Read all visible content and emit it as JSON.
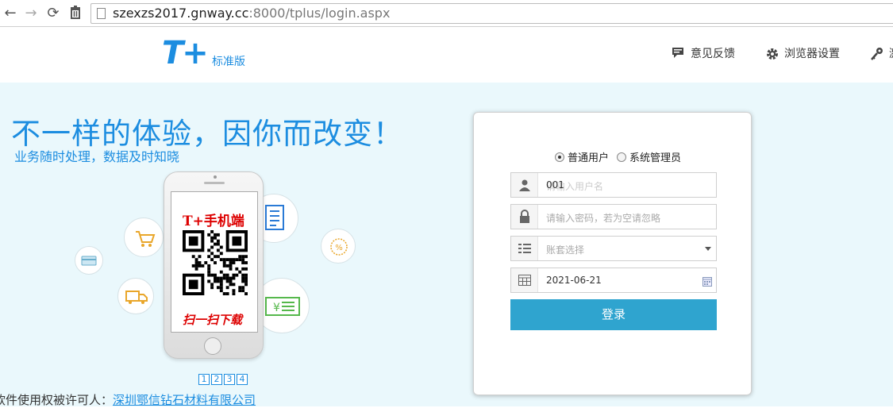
{
  "browser": {
    "url_host": "szexzs2017.gnway.cc",
    "url_rest": ":8000/tplus/login.aspx"
  },
  "header": {
    "logo_text": "T+",
    "logo_sub": "标准版",
    "links": [
      "意见反馈",
      "浏览器设置",
      "激"
    ]
  },
  "hero": {
    "slogan": "不一样的体验，因你而改变！",
    "sub_slogan": "业务随时处理，数据及时知晓",
    "phone_title": "T+手机端",
    "phone_bottom": "扫一扫下载",
    "pager": [
      "1",
      "2",
      "3",
      "4"
    ]
  },
  "license": {
    "label": "软件使用权被许可人：",
    "company": "深圳鄂信钻石材料有限公司"
  },
  "login": {
    "role_normal": "普通用户",
    "role_admin": "系统管理员",
    "username_value": "001",
    "username_placeholder": "请输入用户名",
    "password_placeholder": "请输入密码，若为空请忽略",
    "account_placeholder": "账套选择",
    "date_value": "2021-06-21",
    "submit_label": "登录"
  },
  "colors": {
    "brand_blue": "#1c8de0",
    "login_button": "#2fa4cf",
    "hero_bg": "#eaf8fc",
    "phone_text_red": "#dd0000"
  }
}
